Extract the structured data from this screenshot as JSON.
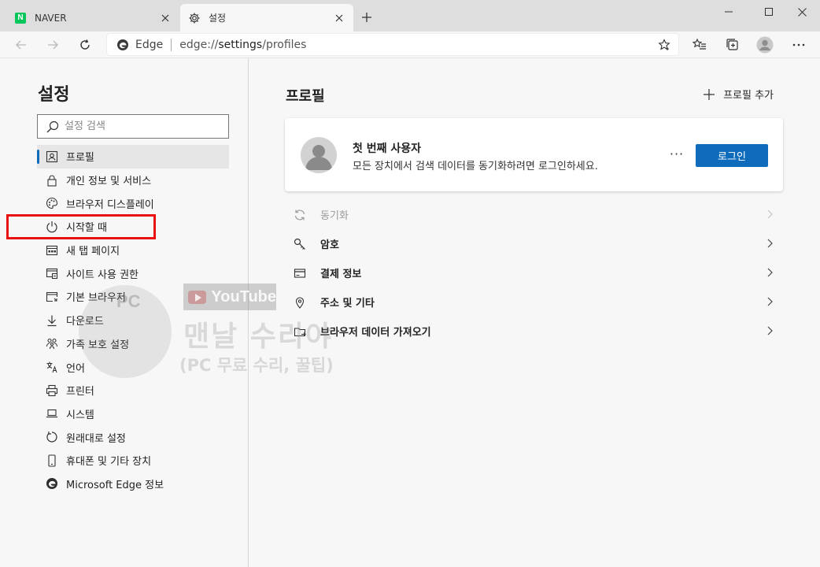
{
  "tabs": [
    {
      "title": "NAVER",
      "favicon_letter": "N",
      "active": false
    },
    {
      "title": "설정",
      "active": true
    }
  ],
  "toolbar": {
    "address_brand": "Edge",
    "url_prefix": "edge://",
    "url_host": "settings",
    "url_path": "/profiles"
  },
  "sidebar": {
    "title": "설정",
    "search_placeholder": "설정 검색",
    "items": [
      {
        "label": "프로필",
        "icon": "profile-icon",
        "active": true
      },
      {
        "label": "개인 정보 및 서비스",
        "icon": "lock-icon"
      },
      {
        "label": "브라우저 디스플레이",
        "icon": "palette-icon"
      },
      {
        "label": "시작할 때",
        "icon": "power-icon"
      },
      {
        "label": "새 탭 페이지",
        "icon": "new-tab-icon"
      },
      {
        "label": "사이트 사용 권한",
        "icon": "site-permissions-icon"
      },
      {
        "label": "기본 브라우저",
        "icon": "default-browser-icon"
      },
      {
        "label": "다운로드",
        "icon": "download-icon"
      },
      {
        "label": "가족 보호 설정",
        "icon": "family-icon"
      },
      {
        "label": "언어",
        "icon": "language-icon"
      },
      {
        "label": "프린터",
        "icon": "printer-icon"
      },
      {
        "label": "시스템",
        "icon": "system-icon"
      },
      {
        "label": "원래대로 설정",
        "icon": "reset-icon"
      },
      {
        "label": "휴대폰 및 기타 장치",
        "icon": "phone-icon"
      },
      {
        "label": "Microsoft Edge 정보",
        "icon": "edge-icon"
      }
    ]
  },
  "main": {
    "title": "프로필",
    "add_profile_label": "프로필 추가",
    "profile": {
      "name": "첫 번째 사용자",
      "description": "모든 장치에서 검색 데이터를 동기화하려면 로그인하세요.",
      "more_label": "···",
      "login_label": "로그인"
    },
    "rows": [
      {
        "label": "동기화",
        "icon": "sync-icon",
        "disabled": true
      },
      {
        "label": "암호",
        "icon": "key-icon"
      },
      {
        "label": "결제 정보",
        "icon": "card-icon"
      },
      {
        "label": "주소 및 기타",
        "icon": "location-icon"
      },
      {
        "label": "브라우저 데이터 가져오기",
        "icon": "import-icon"
      }
    ]
  },
  "watermark": {
    "youtube": "YouTube",
    "pc_mark": "PC",
    "title": "맨날 수리야",
    "subtitle": "(PC 무료 수리, 꿀팁)"
  },
  "colors": {
    "accent": "#0f6cbd",
    "highlight_box": "#e81010",
    "naver_green": "#03c75a"
  }
}
